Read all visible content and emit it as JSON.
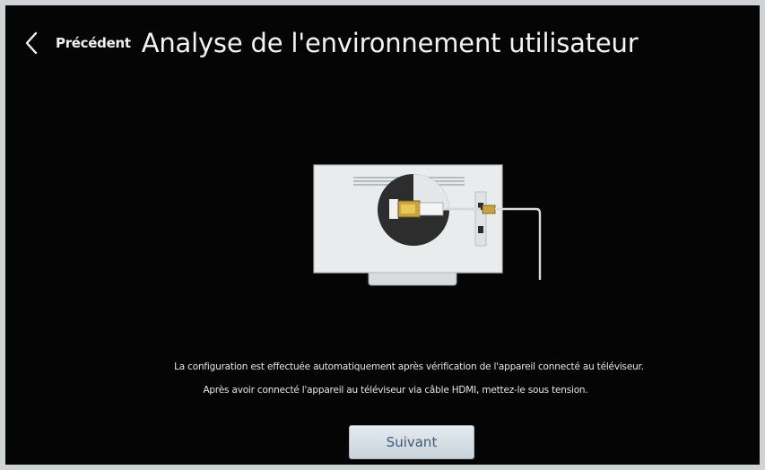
{
  "header": {
    "back_label": "Précédent",
    "title": "Analyse de l'environnement utilisateur"
  },
  "description": {
    "line1": "La configuration est effectuée automatiquement après vérification de l'appareil connecté au téléviseur.",
    "line2": "Après avoir connecté l'appareil au téléviseur via câble HDMI, mettez-le sous tension."
  },
  "buttons": {
    "next_label": "Suivant"
  },
  "icons": {
    "back": "chevron-left-icon",
    "illustration": "tv-hdmi-connection-illustration"
  },
  "colors": {
    "background": "#050505",
    "text": "#e8e8e8",
    "button_bg": "#d6dee3",
    "button_text": "#3c5a7a"
  }
}
